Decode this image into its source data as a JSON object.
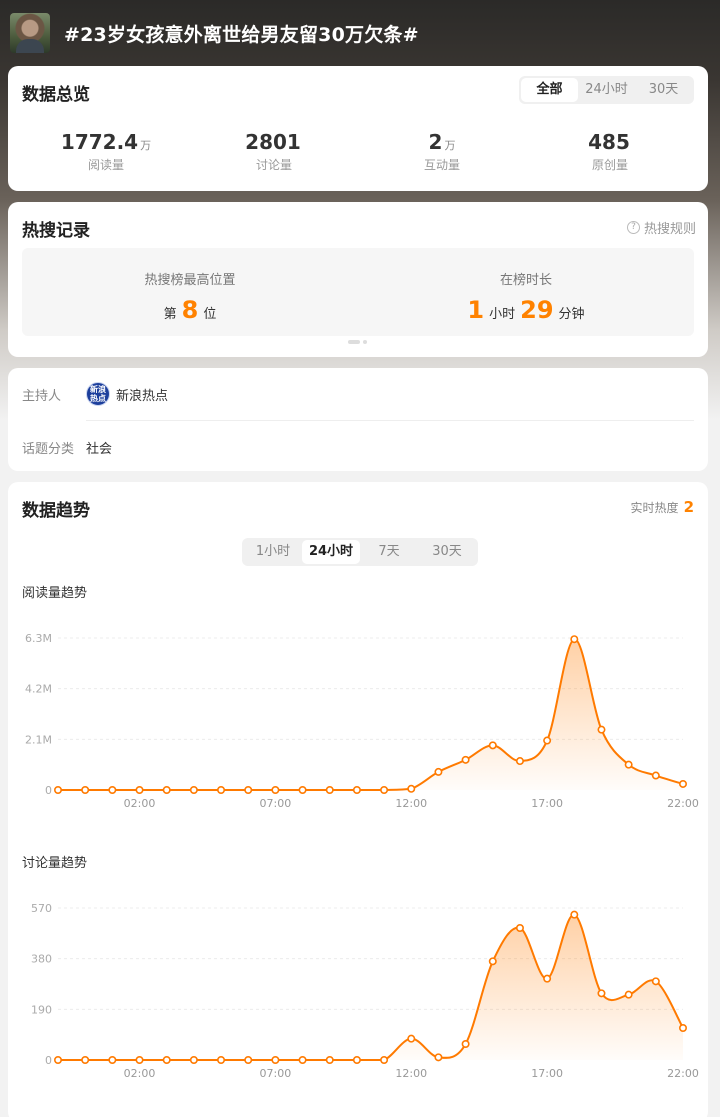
{
  "topic": {
    "title": "#23岁女孩意外离世给男友留30万欠条#"
  },
  "overview": {
    "title": "数据总览",
    "tabs": [
      "全部",
      "24小时",
      "30天"
    ],
    "stats": [
      {
        "value": "1772.4",
        "unit": "万",
        "label": "阅读量"
      },
      {
        "value": "2801",
        "unit": "",
        "label": "讨论量"
      },
      {
        "value": "2",
        "unit": "万",
        "label": "互动量"
      },
      {
        "value": "485",
        "unit": "",
        "label": "原创量"
      }
    ]
  },
  "hot_record": {
    "title": "热搜记录",
    "rules_label": "热搜规则",
    "rules_icon": "question-circle-icon",
    "max_position_label": "热搜榜最高位置",
    "max_position_prefix": "第",
    "max_position_value": "8",
    "max_position_suffix": "位",
    "duration_label": "在榜时长",
    "duration_hours": "1",
    "duration_hours_unit": "小时",
    "duration_minutes": "29",
    "duration_minutes_unit": "分钟"
  },
  "info": {
    "host_label": "主持人",
    "host_name": "新浪热点",
    "host_logo_text": "新浪热点",
    "category_label": "话题分类",
    "category_value": "社会"
  },
  "trend": {
    "title": "数据趋势",
    "realtime_label": "实时热度",
    "realtime_value": "2",
    "tabs": [
      "1小时",
      "24小时",
      "7天",
      "30天"
    ],
    "active_tab": 1,
    "accent_color": "#ff7a00"
  },
  "chart_data": [
    {
      "type": "area",
      "title": "阅读量趋势",
      "x_ticks": [
        "02:00",
        "07:00",
        "12:00",
        "17:00",
        "22:00"
      ],
      "y_ticks": [
        "0",
        "2.1M",
        "4.2M",
        "6.3M"
      ],
      "ylim": [
        0,
        6.3
      ],
      "y_unit": "M",
      "x": [
        "23:00",
        "00:00",
        "01:00",
        "02:00",
        "03:00",
        "04:00",
        "05:00",
        "06:00",
        "07:00",
        "08:00",
        "09:00",
        "10:00",
        "11:00",
        "12:00",
        "13:00",
        "14:00",
        "15:00",
        "16:00",
        "17:00",
        "18:00",
        "19:00",
        "20:00",
        "21:00",
        "22:00"
      ],
      "values": [
        0,
        0,
        0,
        0,
        0,
        0,
        0,
        0,
        0,
        0,
        0,
        0,
        0,
        0.05,
        0.75,
        1.25,
        1.85,
        1.2,
        2.05,
        6.25,
        2.5,
        1.05,
        0.6,
        0.25
      ]
    },
    {
      "type": "area",
      "title": "讨论量趋势",
      "x_ticks": [
        "02:00",
        "07:00",
        "12:00",
        "17:00",
        "22:00"
      ],
      "y_ticks": [
        "0",
        "190",
        "380",
        "570"
      ],
      "ylim": [
        0,
        570
      ],
      "x": [
        "23:00",
        "00:00",
        "01:00",
        "02:00",
        "03:00",
        "04:00",
        "05:00",
        "06:00",
        "07:00",
        "08:00",
        "09:00",
        "10:00",
        "11:00",
        "12:00",
        "13:00",
        "14:00",
        "15:00",
        "16:00",
        "17:00",
        "18:00",
        "19:00",
        "20:00",
        "21:00",
        "22:00"
      ],
      "values": [
        0,
        0,
        0,
        0,
        0,
        0,
        0,
        0,
        0,
        0,
        0,
        0,
        0,
        80,
        10,
        60,
        370,
        495,
        305,
        545,
        250,
        245,
        295,
        120
      ]
    }
  ]
}
